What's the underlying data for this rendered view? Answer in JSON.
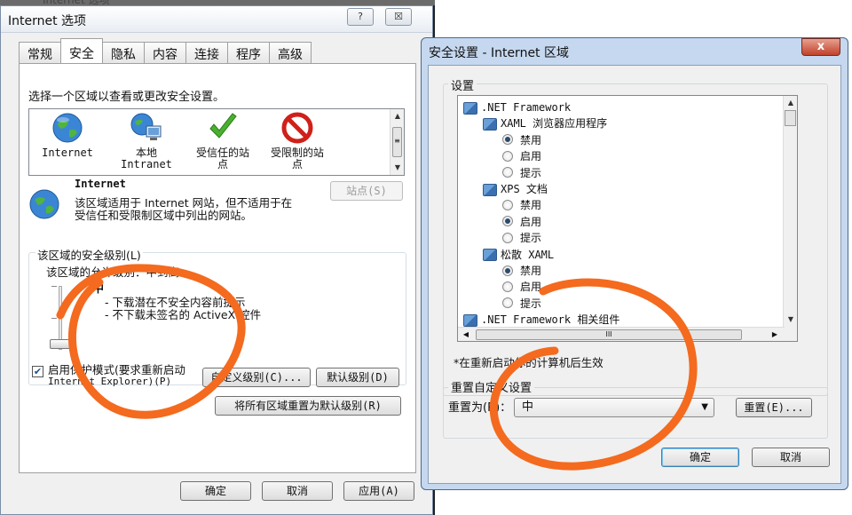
{
  "colors": {
    "annotation": "#f46a1e",
    "close_button": "#c0412a",
    "selected_radio": "#2d4a6b"
  },
  "background_title_snippet": "Internet 选项",
  "internet_options": {
    "title": "Internet 选项",
    "help_icon": "?",
    "close_icon": "☒",
    "tabs": [
      "常规",
      "安全",
      "隐私",
      "内容",
      "连接",
      "程序",
      "高级"
    ],
    "select_zone_label": "选择一个区域以查看或更改安全设置。",
    "zones": [
      {
        "line1": "Internet",
        "line2": "",
        "icon": "globe-icon"
      },
      {
        "line1": "本地",
        "line2": "Intranet",
        "icon": "intranet-icon"
      },
      {
        "line1": "受信任的站",
        "line2": "点",
        "icon": "check-icon"
      },
      {
        "line1": "受限制的站",
        "line2": "点",
        "icon": "restricted-icon"
      }
    ],
    "zone_name": "Internet",
    "zone_desc_1": "该区域适用于 Internet 网站，但不适用于在",
    "zone_desc_2": "受信任和受限制区域中列出的网站。",
    "sites_button": "站点(S)",
    "security_level_group": "该区域的安全级别(L)",
    "allowed_levels": "该区域的允许级别：中到高",
    "level_name": "中",
    "level_bullet_1": "- 下载潜在不安全内容前提示",
    "level_bullet_2": "- 不下载未签名的 ActiveX 控件",
    "protected_mode_checked": true,
    "protected_mode_line1": "启用保护模式(要求重新启动",
    "protected_mode_line2": "Internet Explorer)(P)",
    "custom_level_button": "自定义级别(C)...",
    "default_level_button": "默认级别(D)",
    "reset_all_button": "将所有区域重置为默认级别(R)",
    "ok_button": "确定",
    "cancel_button": "取消",
    "apply_button": "应用(A)"
  },
  "security_settings": {
    "title": "安全设置 - Internet 区域",
    "close_icon": "x",
    "settings_label": "设置",
    "tree": [
      {
        "type": "node",
        "indent": 0,
        "text": ".NET Framework"
      },
      {
        "type": "node",
        "indent": 1,
        "text": "XAML 浏览器应用程序"
      },
      {
        "type": "radio",
        "indent": 2,
        "text": "禁用",
        "checked": true
      },
      {
        "type": "radio",
        "indent": 2,
        "text": "启用",
        "checked": false
      },
      {
        "type": "radio",
        "indent": 2,
        "text": "提示",
        "checked": false
      },
      {
        "type": "node",
        "indent": 1,
        "text": "XPS 文档"
      },
      {
        "type": "radio",
        "indent": 2,
        "text": "禁用",
        "checked": false
      },
      {
        "type": "radio",
        "indent": 2,
        "text": "启用",
        "checked": true
      },
      {
        "type": "radio",
        "indent": 2,
        "text": "提示",
        "checked": false
      },
      {
        "type": "node",
        "indent": 1,
        "text": "松散 XAML"
      },
      {
        "type": "radio",
        "indent": 2,
        "text": "禁用",
        "checked": true
      },
      {
        "type": "radio",
        "indent": 2,
        "text": "启用",
        "checked": false
      },
      {
        "type": "radio",
        "indent": 2,
        "text": "提示",
        "checked": false
      },
      {
        "type": "node",
        "indent": 0,
        "text": ".NET Framework 相关组件"
      }
    ],
    "hscroll_thumb": "III",
    "restart_note": "*在重新启动你的计算机后生效",
    "reset_group": "重置自定义设置",
    "reset_to_label": "重置为(R)：",
    "reset_to_value": "中",
    "reset_button": "重置(E)...",
    "ok_button": "确定",
    "cancel_button": "取消"
  }
}
